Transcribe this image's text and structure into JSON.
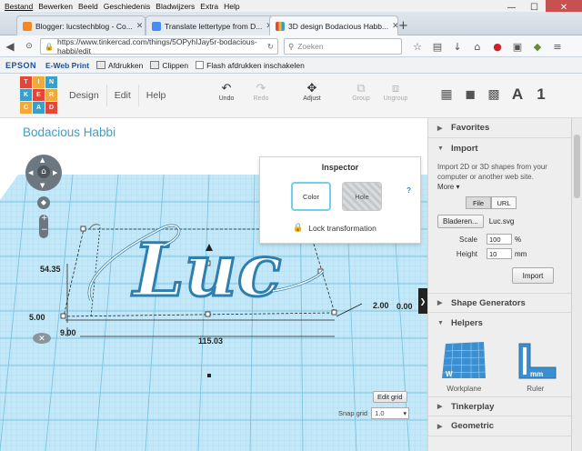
{
  "menu": [
    "Bestand",
    "Bewerken",
    "Beeld",
    "Geschiedenis",
    "Bladwijzers",
    "Extra",
    "Help"
  ],
  "window_controls": {
    "minimize": "—",
    "maximize": "☐",
    "close": "✕"
  },
  "tabs": [
    {
      "label": "Blogger: lucstechblog - Co...",
      "color": "#f08a24"
    },
    {
      "label": "Translate lettertype from D...",
      "color": "#4a8af4"
    },
    {
      "label": "3D design Bodacious Habb...",
      "color": "#e04a3c"
    }
  ],
  "new_tab": "+",
  "url": "https://www.tinkercad.com/things/5OPyhIJay5r-bodacious-habbi/edit",
  "search_placeholder": "Zoeken",
  "epson": {
    "logo": "EPSON",
    "eweb": "E-Web Print",
    "print": "Afdrukken",
    "clips": "Clippen",
    "flash": "Flash afdrukken inschakelen"
  },
  "logo_letters": [
    "TIN",
    "KER",
    "CAD"
  ],
  "app_nav": [
    "Design",
    "Edit",
    "Help"
  ],
  "toolbar": {
    "undo": "Undo",
    "redo": "Redo",
    "adjust": "Adjust",
    "group": "Group",
    "ungroup": "Ungroup"
  },
  "view": {
    "letter": "A",
    "number": "1"
  },
  "project_name": "Bodacious Habbi",
  "inspector": {
    "title": "Inspector",
    "help": "?",
    "color": "Color",
    "hole": "Hole",
    "lock": "Lock transformation"
  },
  "panel": {
    "favorites": "Favorites",
    "import": "Import",
    "import_text": "Import 2D or 3D shapes from your computer or another web site.",
    "more": "More",
    "file_tab": "File",
    "url_tab": "URL",
    "browse": "Bladeren...",
    "filename": "Luc.svg",
    "scale_label": "Scale",
    "scale_value": "100",
    "scale_unit": "%",
    "height_label": "Height",
    "height_value": "10",
    "height_unit": "mm",
    "import_btn": "Import",
    "shape_generators": "Shape Generators",
    "helpers": "Helpers",
    "workplane": "Workplane",
    "ruler": "Ruler",
    "tinkerplay": "Tinkerplay",
    "geometric": "Geometric"
  },
  "canvas": {
    "dim_54": "54.35",
    "dim_5": "5.00",
    "dim_9": "9.00",
    "dim_115": "115.03",
    "dim_2": "2.00",
    "dim_0": "0.00",
    "text_shape": "Luc",
    "edit_grid": "Edit grid",
    "snap_label": "Snap grid",
    "snap_value": "1.0"
  },
  "colors": {
    "accent": "#3ba0c8",
    "grid_bg": "#b9e2f4",
    "grid_line": "#8ccbe6",
    "shape_fill": "#ffffff",
    "shape_outline": "#2f7fae"
  }
}
